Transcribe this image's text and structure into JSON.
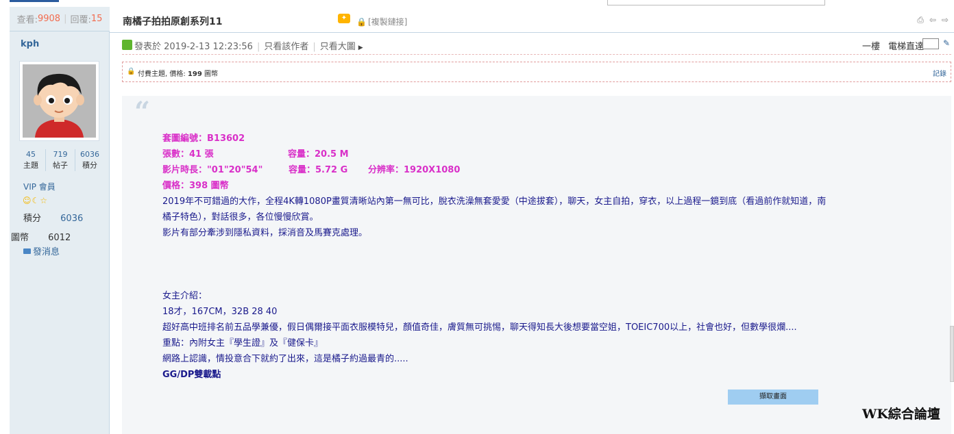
{
  "header": {
    "views_label": "查看:",
    "views_value": "9908",
    "replies_label": "回覆:",
    "replies_value": "15",
    "title": "南橘子拍拍原創系列11",
    "copy_link": "[複製鏈接]"
  },
  "author": {
    "name": "kph",
    "stats": [
      {
        "value": "45",
        "label": "主題"
      },
      {
        "value": "719",
        "label": "帖子"
      },
      {
        "value": "6036",
        "label": "積分"
      }
    ],
    "group": "VIP 會員",
    "credit_label": "積分",
    "credit_value": "6036",
    "coin_label": "圖幣",
    "coin_value": "6012",
    "message_label": "發消息"
  },
  "post_meta": {
    "posted": "發表於 2019-2-13 12:23:56",
    "only_author": "只看該作者",
    "only_large": "只看大圖",
    "floor": "一樓",
    "jump_label": "電梯直達"
  },
  "paid": {
    "text": "付費主題, 價格:",
    "price": "199",
    "unit": "圖幣",
    "record": "記錄"
  },
  "content": {
    "line1": "套圖編號：B13602",
    "line2a": "張數：41 張",
    "line2b": "容量：20.5 M",
    "line3a": "影片時長：\"01\"20\"54\"",
    "line3b": "容量：5.72 G",
    "line3c": "分辨率：1920X1080",
    "line4": "價格：398 圖幣",
    "line5": "2019年不可錯過的大作，全程4K轉1080P畫質清晰站內第一無可比，脫衣洗澡無套愛愛（中途拔套），聊天，女主自拍，穿衣，以上過程一鏡到底（看過前作就知道，南",
    "line6": "橘子特色），對話很多，各位慢慢欣賞。",
    "line7": "影片有部分牽涉到隱私資料，採消音及馬賽克處理。",
    "line8": "女主介紹：",
    "line9": "18才，167CM，32B 28 40",
    "line10": "超好高中班排名前五品學兼優，假日偶爾接平面衣服模特兒，顏值奇佳，膚質無可挑惕，聊天得知長大後想要當空姐，TOEIC700以上，社會也好，但數學很爛....",
    "line11": "重點：內附女主『學生證』及『健保卡』",
    "line12": "網路上認識，情投意合下就約了出來，這是橘子約過最青的.....",
    "line13": "GG/DP雙載點",
    "screenshot_button": "擷取畫面"
  },
  "watermark": "WK綜合論壇",
  "colors": {
    "sidebar_bg": "#e5edf2",
    "accent_magenta": "#d930c8",
    "link_blue": "#336699",
    "navy_text": "#1a1a8c"
  }
}
